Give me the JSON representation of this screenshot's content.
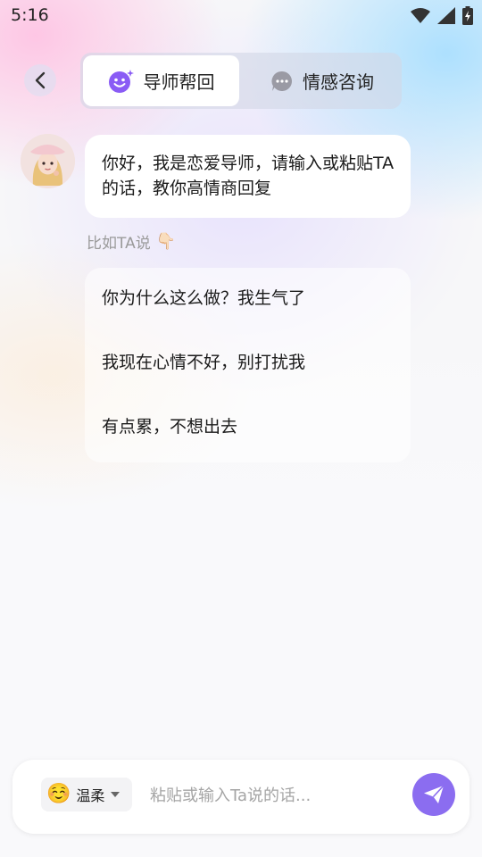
{
  "status_bar": {
    "time": "5:16",
    "icons": [
      "wifi-icon",
      "signal-icon",
      "battery-charging-icon"
    ]
  },
  "header": {
    "back_icon": "chevron-left-icon",
    "tabs": [
      {
        "label": "导师帮回",
        "icon": "smiley-sparkle-icon",
        "active": true
      },
      {
        "label": "情感咨询",
        "icon": "chat-bubble-icon",
        "active": false
      }
    ]
  },
  "chat": {
    "intro_message": "你好，我是恋爱导师，请输入或粘贴TA的话，教你高情商回复",
    "hint": "比如TA说",
    "hint_icon": "👇🏻",
    "examples": [
      "你为什么这么做？我生气了",
      "我现在心情不好，别打扰我",
      "有点累，不想出去"
    ]
  },
  "input_bar": {
    "tone_emoji": "☺️",
    "tone_label": "温柔",
    "placeholder": "粘贴或输入Ta说的话...",
    "send_icon": "paper-plane-icon"
  },
  "colors": {
    "accent": "#8b6df0",
    "accent_icon": "#8a5cf5"
  }
}
